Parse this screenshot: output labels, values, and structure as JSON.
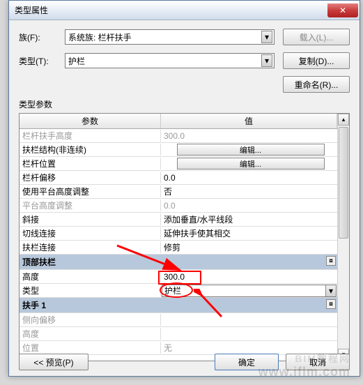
{
  "window": {
    "title": "类型属性",
    "close_icon": "✕"
  },
  "form": {
    "family_label": "族(F):",
    "family_value": "系统族: 栏杆扶手",
    "type_label": "类型(T):",
    "type_value": "护栏"
  },
  "buttons": {
    "load": "载入(L)...",
    "duplicate": "复制(D)...",
    "rename": "重命名(R)...",
    "edit": "编辑...",
    "preview": "<< 预览(P)",
    "ok": "确定",
    "cancel": "取消"
  },
  "section_label": "类型参数",
  "table": {
    "header_param": "参数",
    "header_value": "值",
    "rows": [
      {
        "param": "栏杆扶手高度",
        "value": "300.0",
        "disabled": true
      },
      {
        "param": "扶栏结构(非连续)",
        "value_btn": "编辑..."
      },
      {
        "param": "栏杆位置",
        "value_btn": "编辑..."
      },
      {
        "param": "栏杆偏移",
        "value": "0.0"
      },
      {
        "param": "使用平台高度调整",
        "value": "否"
      },
      {
        "param": "平台高度调整",
        "value": "0.0",
        "disabled": true
      },
      {
        "param": "斜接",
        "value": "添加垂直/水平线段"
      },
      {
        "param": "切线连接",
        "value": "延伸扶手使其相交"
      },
      {
        "param": "扶栏连接",
        "value": "修剪"
      }
    ],
    "section_top": "顶部扶栏",
    "top_rows": [
      {
        "param": "高度",
        "value": "300.0",
        "highlight": "box"
      },
      {
        "param": "类型",
        "value": "护栏",
        "highlight": "oval",
        "dropdown": true
      }
    ],
    "section_handrail": "扶手 1",
    "handrail_rows": [
      {
        "param": "侧向偏移",
        "value": "",
        "disabled": true
      },
      {
        "param": "高度",
        "value": "",
        "disabled": true
      },
      {
        "param": "位置",
        "value": "无",
        "disabled": true
      }
    ]
  },
  "watermark": "www.iflm.com",
  "watermark_brand": "BIM教程网"
}
